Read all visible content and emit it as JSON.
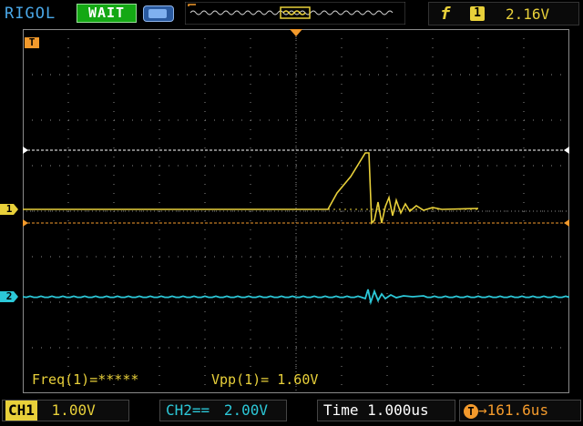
{
  "header": {
    "brand": "RIGOL",
    "status": "WAIT",
    "trigger": {
      "symbol": "f",
      "source": "1",
      "level": "2.16V"
    }
  },
  "markers": {
    "trigger": "T",
    "ch1": "1",
    "ch2": "2"
  },
  "measurements": {
    "freq": "Freq(1)=*****",
    "vpp": "Vpp(1)=  1.60V"
  },
  "footer": {
    "ch1_label": "CH1",
    "ch1_scale": "1.00V",
    "ch2_label": "CH2",
    "ch2_coupling": "==",
    "ch2_scale": "2.00V",
    "time_label": "Time",
    "time_scale": "1.000us",
    "trigger_offset_tag": "T",
    "trigger_offset": "161.6us"
  },
  "colors": {
    "ch1": "#e8d03a",
    "ch2": "#2cc8d8",
    "trigger": "#f39a2c",
    "grid": "#8a8a8a",
    "cursor": "#ffffff"
  },
  "icons": [
    "battery-icon",
    "memory-waveform-icon",
    "trigger-edge-icon"
  ]
}
